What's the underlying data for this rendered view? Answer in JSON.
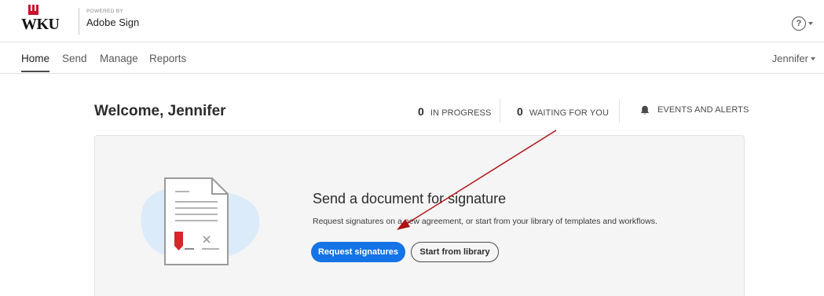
{
  "header": {
    "logo_text": "WKU",
    "powered_by": "POWERED BY",
    "product_name": "Adobe Sign",
    "help_icon": "?"
  },
  "nav": {
    "items": [
      {
        "label": "Home",
        "active": true
      },
      {
        "label": "Send",
        "active": false
      },
      {
        "label": "Manage",
        "active": false
      },
      {
        "label": "Reports",
        "active": false
      }
    ],
    "user": "Jennifer"
  },
  "welcome": {
    "title": "Welcome, Jennifer",
    "in_progress": {
      "count": "0",
      "label": "IN PROGRESS"
    },
    "waiting": {
      "count": "0",
      "label": "WAITING FOR YOU"
    },
    "events_label": "EVENTS AND ALERTS"
  },
  "card": {
    "title": "Send a document for signature",
    "description": "Request signatures on a new agreement, or start from your library of templates and workflows.",
    "primary_button": "Request signatures",
    "secondary_button": "Start from library"
  },
  "colors": {
    "brand_red": "#c8102e",
    "primary_blue": "#1473e6",
    "annotation_arrow": "#b01010"
  },
  "icons": [
    "help-icon",
    "caret-down-icon",
    "bell-icon",
    "document-illustration",
    "annotation-arrow"
  ]
}
